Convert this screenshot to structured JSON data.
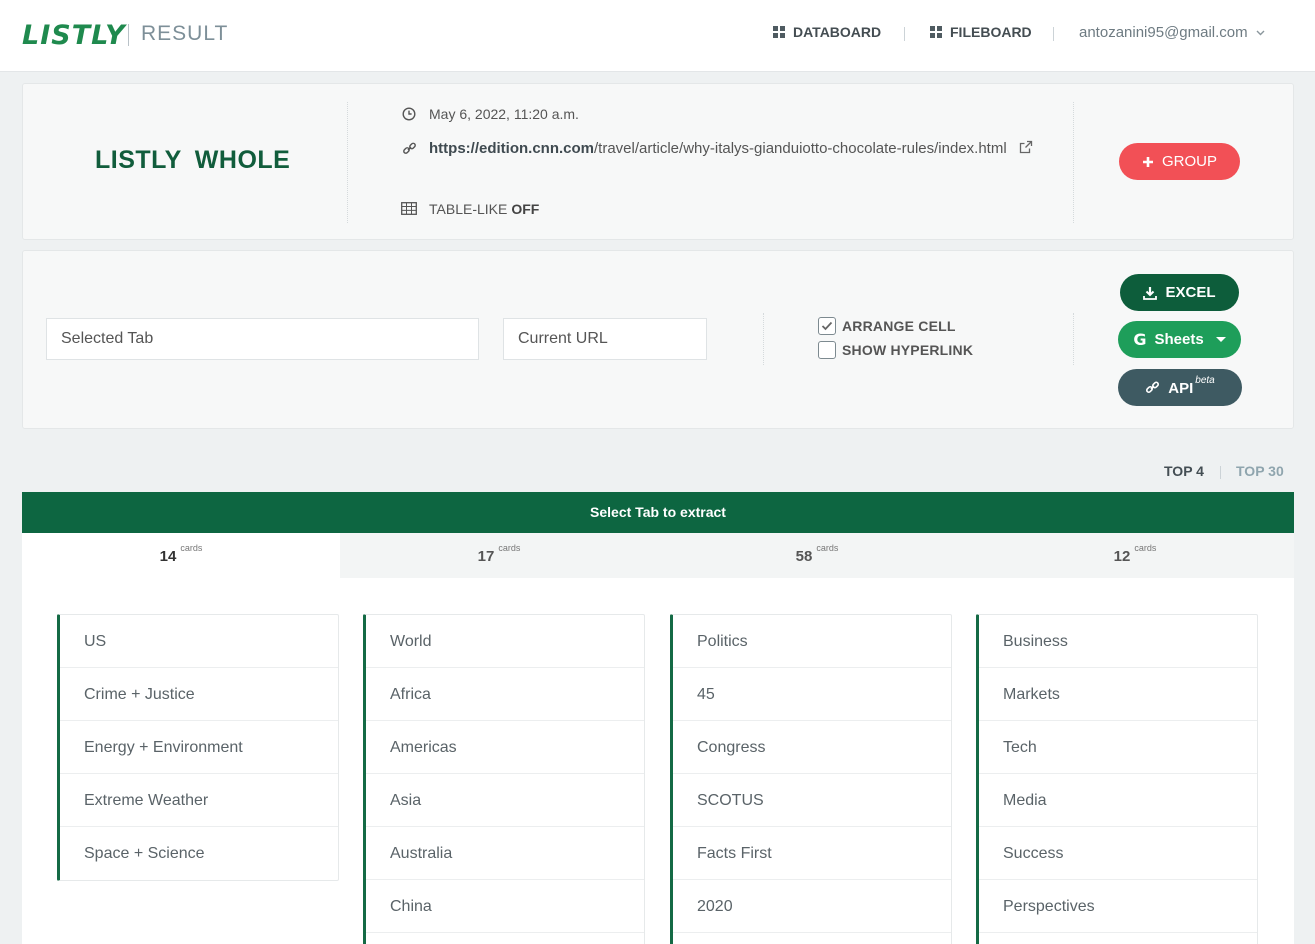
{
  "header": {
    "logo": "LISTLY",
    "subtitle": "RESULT",
    "nav": [
      {
        "label": "DATABOARD",
        "icon": "grid-icon"
      },
      {
        "label": "FILEBOARD",
        "icon": "grid-icon"
      }
    ],
    "user_email": "antozanini95@gmail.com"
  },
  "summary": {
    "title": "LISTLY  WHOLE",
    "date": "May 6, 2022, 11:20 a.m.",
    "url_domain": "https://edition.cnn.com",
    "url_path": "/travel/article/why-italys-gianduiotto-chocolate-rules/index.html",
    "table_like_label": "TABLE-LIKE",
    "table_like_value": "OFF",
    "group_button": "GROUP"
  },
  "export": {
    "selected_tab_placeholder": "Selected Tab",
    "current_url_placeholder": "Current URL",
    "arrange_cell": {
      "label": "ARRANGE CELL",
      "checked": true
    },
    "show_hyperlink": {
      "label": "SHOW HYPERLINK",
      "checked": false
    },
    "excel_button": "EXCEL",
    "sheets_button": "Sheets",
    "api_button": "API",
    "api_badge": "beta"
  },
  "top_toggle": {
    "options": [
      "TOP 4",
      "TOP 30"
    ],
    "active": "TOP 4"
  },
  "select_bar": "Select Tab to extract",
  "tabs": [
    {
      "count": "14",
      "unit": "cards",
      "active": true
    },
    {
      "count": "17",
      "unit": "cards",
      "active": false
    },
    {
      "count": "58",
      "unit": "cards",
      "active": false
    },
    {
      "count": "12",
      "unit": "cards",
      "active": false
    }
  ],
  "columns": [
    [
      "US",
      "Crime + Justice",
      "Energy + Environment",
      "Extreme Weather",
      "Space + Science"
    ],
    [
      "World",
      "Africa",
      "Americas",
      "Asia",
      "Australia",
      "China",
      ""
    ],
    [
      "Politics",
      "45",
      "Congress",
      "SCOTUS",
      "Facts First",
      "2020",
      ""
    ],
    [
      "Business",
      "Markets",
      "Tech",
      "Media",
      "Success",
      "Perspectives",
      ""
    ]
  ],
  "colors": {
    "brand_green": "#1f8a4e",
    "dark_green": "#0d5d3b",
    "group_red": "#f25056",
    "sheets_green": "#1e9e5a",
    "api_slate": "#3e5a62"
  }
}
